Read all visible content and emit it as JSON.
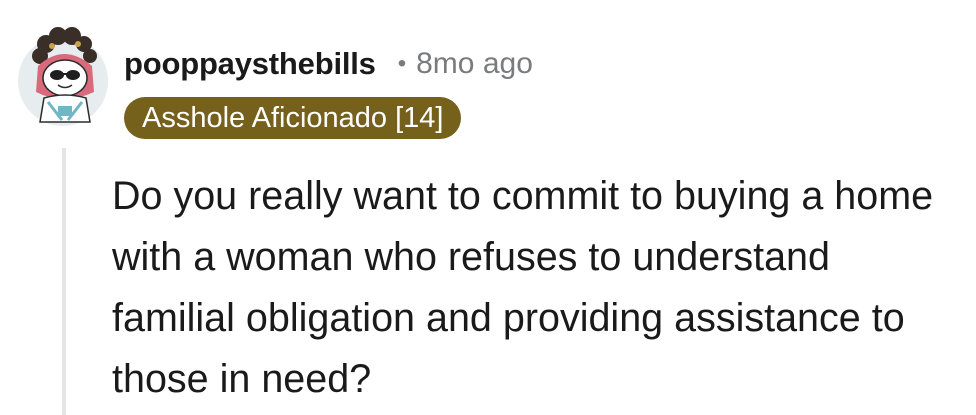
{
  "comment": {
    "username": "pooppaysthebills",
    "separator": "•",
    "timestamp": "8mo ago",
    "flair": "Asshole Aficionado [14]",
    "body": "Do you really want to commit to buying a home with a woman who refuses to understand familial obligation and providing assistance to those in need?",
    "avatar_icon": "snoo-avatar-icon"
  },
  "colors": {
    "flair_background": "#75611c",
    "flair_text": "#ffffff",
    "meta_text": "#787c7e",
    "thread_line": "#e5e5e5"
  }
}
